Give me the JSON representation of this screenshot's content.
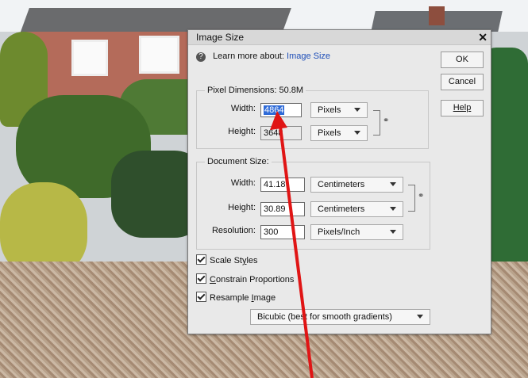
{
  "dialog": {
    "title": "Image Size",
    "close": "✕",
    "help_prefix": "Learn more about:",
    "help_link": "Image Size"
  },
  "buttons": {
    "ok": "OK",
    "cancel": "Cancel",
    "help": "Help"
  },
  "pixel_dimensions": {
    "legend": "Pixel Dimensions:  50.8M",
    "width_label": "Width:",
    "width_value": "4864",
    "width_unit": "Pixels",
    "height_label": "Height:",
    "height_value": "3648",
    "height_unit": "Pixels"
  },
  "document_size": {
    "legend": "Document Size:",
    "width_label": "Width:",
    "width_value": "41.18",
    "width_unit": "Centimeters",
    "height_label": "Height:",
    "height_value": "30.89",
    "height_unit": "Centimeters",
    "resolution_label": "Resolution:",
    "resolution_value": "300",
    "resolution_unit": "Pixels/Inch"
  },
  "options": {
    "scale_styles": {
      "pre": "Scale St",
      "ul": "y",
      "post": "les"
    },
    "constrain": {
      "pre": "",
      "ul": "C",
      "post": "onstrain Proportions"
    },
    "resample": {
      "pre": "Resample ",
      "ul": "I",
      "post": "mage"
    },
    "resample_method": "Bicubic (best for smooth gradients)"
  },
  "colors": {
    "annotation_arrow": "#e01515",
    "selection": "#2f6bd8",
    "link": "#1f4fb8"
  },
  "icons": {
    "help": "question-circle-icon",
    "chain": "chain-link-icon",
    "dropdown": "chevron-down-icon"
  }
}
